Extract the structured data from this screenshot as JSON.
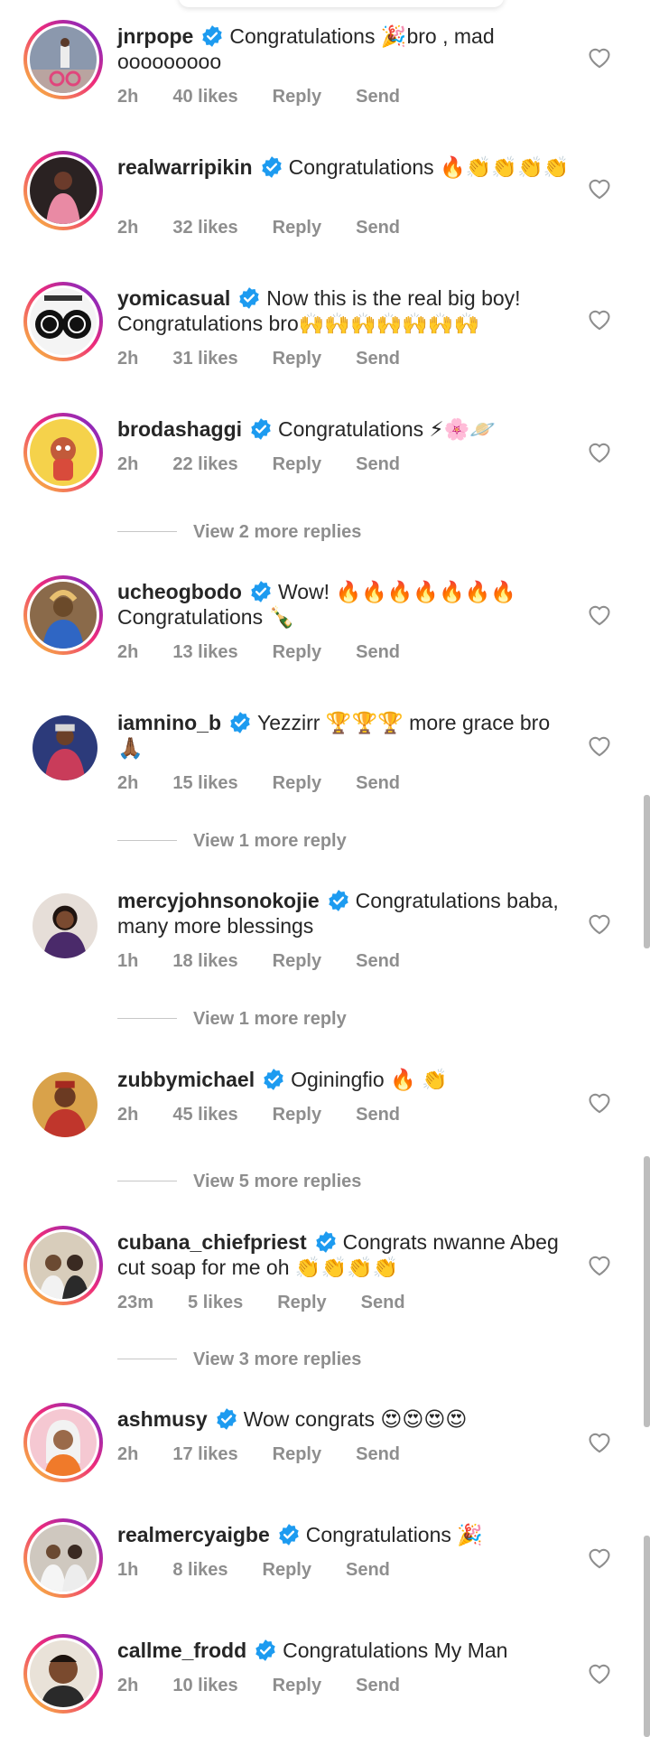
{
  "labels": {
    "reply": "Reply",
    "send": "Send"
  },
  "comments": [
    {
      "username": "jnrpope",
      "text": "Congratulations 🎉bro , mad ooooooooo",
      "time": "2h",
      "likes": "40 likes",
      "avatar_color": "#7a8aa0"
    },
    {
      "username": "realwarripikin",
      "text": "Congratulations 🔥👏👏👏👏",
      "time": "2h",
      "likes": "32 likes",
      "avatar_color": "#3a2b2b"
    },
    {
      "username": "yomicasual",
      "text": "Now this is the real big boy! Congratulations bro🙌🙌🙌🙌🙌🙌🙌",
      "time": "2h",
      "likes": "31 likes",
      "avatar_color": "#111111"
    },
    {
      "username": "brodashaggi",
      "text": "Congratulations ⚡🌸🪐",
      "time": "2h",
      "likes": "22 likes",
      "avatar_color": "#f2c84a"
    },
    {
      "username": "ucheogbodo",
      "text": "Wow! 🔥🔥🔥🔥🔥🔥🔥 Congratulations 🍾",
      "time": "2h",
      "likes": "13 likes",
      "avatar_color": "#9a7a5a"
    },
    {
      "username": "iamnino_b",
      "text": "Yezzirr 🏆🏆🏆 more grace bro 🙏🏾",
      "time": "2h",
      "likes": "15 likes",
      "avatar_color": "#3a3f7a"
    },
    {
      "username": "mercyjohnsonokojie",
      "text": "Congratulations baba, many more blessings",
      "time": "1h",
      "likes": "18 likes",
      "avatar_color": "#3a2a4a"
    },
    {
      "username": "zubbymichael",
      "text": "Oginingfio 🔥 👏",
      "time": "2h",
      "likes": "45 likes",
      "avatar_color": "#b4432e"
    },
    {
      "username": "cubana_chiefpriest",
      "text": "Congrats nwanne Abeg cut soap for me oh 👏👏👏👏",
      "time": "23m",
      "likes": "5 likes",
      "avatar_color": "#c9b8a0"
    },
    {
      "username": "ashmusy",
      "text": "Wow congrats 😍😍😍😍",
      "time": "2h",
      "likes": "17 likes",
      "avatar_color": "#f0a0b0"
    },
    {
      "username": "realmercyaigbe",
      "text": "Congratulations 🎉",
      "time": "1h",
      "likes": "8 likes",
      "avatar_color": "#d8d0c4"
    },
    {
      "username": "callme_frodd",
      "text": "Congratulations My Man",
      "time": "2h",
      "likes": "10 likes",
      "avatar_color": "#6b4a32"
    }
  ],
  "view_more": [
    "View 2 more replies",
    "View 1 more reply",
    "View 1 more reply",
    "View 5 more replies",
    "View 3 more replies"
  ]
}
